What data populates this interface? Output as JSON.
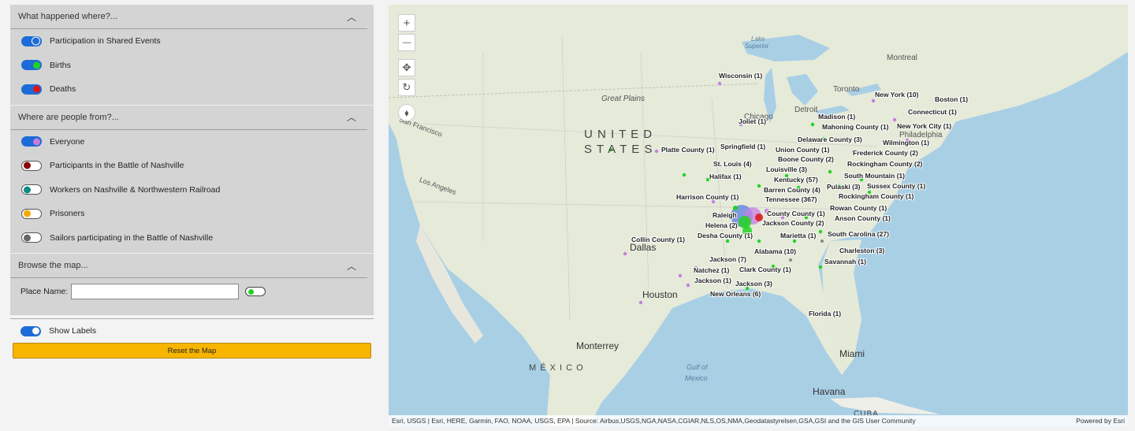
{
  "sections": {
    "events": {
      "title": "What happened where?...",
      "items": [
        {
          "label": "Participation in Shared Events",
          "knob_color": "#1d6bd6",
          "on": true
        },
        {
          "label": "Births",
          "knob_color": "#22d322",
          "on": true
        },
        {
          "label": "Deaths",
          "knob_color": "#e01414",
          "on": true
        }
      ]
    },
    "people": {
      "title": "Where are people from?...",
      "items": [
        {
          "label": "Everyone",
          "knob_color": "#c77ee0",
          "on": true
        },
        {
          "label": "Participants in the Battle of Nashville",
          "knob_color": "#8b0000",
          "on": false
        },
        {
          "label": "Workers on Nashville & Northwestern Railroad",
          "knob_color": "#0e8a86",
          "on": false
        },
        {
          "label": "Prisoners",
          "knob_color": "#f5a800",
          "on": false
        },
        {
          "label": "Sailors participating in the Battle of Nashville",
          "knob_color": "#666666",
          "on": false
        }
      ]
    },
    "browse": {
      "title": "Browse the map...",
      "place_label": "Place Name:",
      "place_value": "",
      "place_toggle_color": "#22d322"
    }
  },
  "show_labels": "Show Labels",
  "reset_label": "Reset the Map",
  "map": {
    "controls": {
      "zoom_in": "+",
      "zoom_out": "—",
      "pan": "✥",
      "rotate": "↻",
      "compass": "⬧"
    },
    "basemap_labels": {
      "united": "U N I T E D",
      "states": "S T A T E S",
      "great_plains": "Great Plains",
      "lake_superior_1": "Lake",
      "lake_superior_2": "Superior",
      "montreal": "Montreal",
      "toronto": "Toronto",
      "detroit": "Detroit",
      "chicago": "Chicago",
      "philadelphia": "Philadelphia",
      "los_angeles": "Los Angeles",
      "san_francisco": "San Francisco",
      "dallas": "Dallas",
      "houston": "Houston",
      "monterrey": "Monterrey",
      "mexico": "M É X I C O",
      "gulf1": "Gulf of",
      "gulf2": "Mexico",
      "miami": "Miami",
      "havana": "Havana",
      "cuba": "CUBA"
    },
    "place_labels": [
      "Wisconsin (1)",
      "New York (10)",
      "Boston (1)",
      "Connecticut (1)",
      "Joliet (1)",
      "Madison (1)",
      "Mahoning County (1)",
      "New York City (1)",
      "Delaware County (3)",
      "Wilmington (1)",
      "Platte County (1)",
      "Springfield (1)",
      "Union County (1)",
      "Frederick County (2)",
      "Boone County (2)",
      "Rockingham County (2)",
      "St. Louis (4)",
      "Louisville (3)",
      "South Mountain (1)",
      "Halifax (1)",
      "Kentucky (57)",
      "Pulaski (3)",
      "Sussex County (1)",
      "Barren County (4)",
      "Rockingham County (1)",
      "Harrison County (1)",
      "Tennessee (367)",
      "Rowan County (1)",
      "Raleigh",
      "County County (1)",
      "Anson County (1)",
      "Helena (2)",
      "Jackson County (2)",
      "Desha County (1)",
      "Marietta (1)",
      "South Carolina (27)",
      "Collin County (1)",
      "Alabama (10)",
      "Charleston (3)",
      "Jackson (7)",
      "Savannah (1)",
      "Natchez (1)",
      "Clark County (1)",
      "Jackson (1)",
      "Jackson (3)",
      "New Orleans (6)",
      "Florida (1)"
    ],
    "attribution": "Esri, USGS | Esri, HERE, Garmin, FAO, NOAA, USGS, EPA | Source: Airbus,USGS,NGA,NASA,CGIAR,NLS,OS,NMA,Geodatastyrelsen,GSA,GSI and the GIS User Community",
    "powered_by": "Powered by Esri"
  },
  "colors": {
    "accent": "#1d6bd6",
    "reset": "#f7b500",
    "births": "#22d322",
    "deaths": "#e01414",
    "everyone": "#c77ee0"
  }
}
